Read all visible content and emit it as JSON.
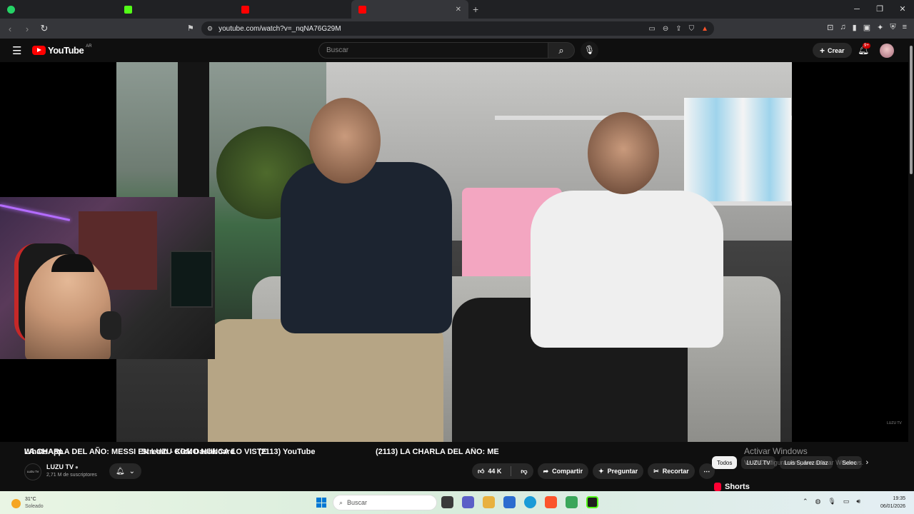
{
  "browser": {
    "tabs": [
      {
        "label": "WhatsApp",
        "color": "#25d366",
        "active": false
      },
      {
        "label": "Stream - Kick Dashboard",
        "color": "#53fc18",
        "active": false
      },
      {
        "label": "(2113) YouTube",
        "color": "#ff0000",
        "active": false
      },
      {
        "label": "(2113) LA CHARLA DEL AÑO: ME",
        "color": "#ff0000",
        "active": true
      }
    ],
    "url": "youtube.com/watch?v=_nqNA76G29M",
    "new_tab": "+"
  },
  "youtube": {
    "logo_text": "YouTube",
    "region": "AR",
    "search_placeholder": "Buscar",
    "create_label": "Crear",
    "notifications_badge": "9+"
  },
  "video": {
    "title": "LA CHARLA DEL AÑO: MESSI EN LUZU COMO NUNCA LO VISTE",
    "channel": {
      "name": "LUZU TV",
      "subscribers": "2,71 M de suscriptores",
      "avatar_text": "LUZU TV"
    },
    "likes": "44 K",
    "actions": {
      "share": "Compartir",
      "ask": "Preguntar",
      "clip": "Recortar"
    },
    "watermark": "LUZU TV"
  },
  "sidebar": {
    "chips": [
      "Todos",
      "LUZU TV",
      "Luis Suárez Díaz",
      "Selec"
    ],
    "shorts_label": "Shorts"
  },
  "windows_activation": {
    "title": "Activar Windows",
    "subtitle": "Ve a Configuración para activar Windows."
  },
  "taskbar": {
    "weather_temp": "31°C",
    "weather_desc": "Soleado",
    "search_placeholder": "Buscar",
    "time": "19:35",
    "date": "06/01/2026",
    "apps": [
      {
        "name": "file-explorer-app",
        "color": "#f9c44b"
      },
      {
        "name": "teams-app",
        "color": "#5b5fc7"
      },
      {
        "name": "folder-app",
        "color": "#e8b13f"
      },
      {
        "name": "store-app",
        "color": "#2c6ccf"
      },
      {
        "name": "edge-app",
        "color": "#1a9bd7"
      },
      {
        "name": "brave-app",
        "color": "#fb542b"
      },
      {
        "name": "xbox-app",
        "color": "#3aa65a"
      },
      {
        "name": "kick-app",
        "color": "#1f1f1f"
      }
    ]
  }
}
